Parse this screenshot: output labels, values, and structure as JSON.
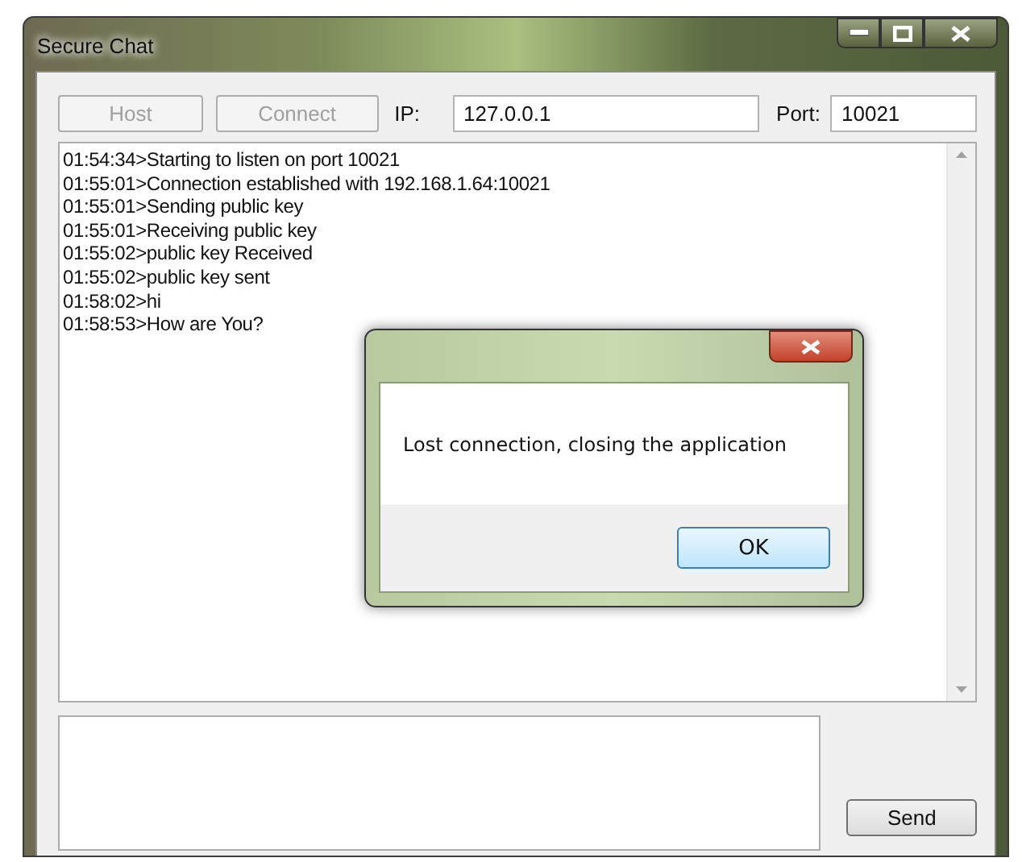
{
  "window": {
    "title": "Secure Chat"
  },
  "toolbar": {
    "buttons": [
      {
        "label": "Host",
        "disabled": true
      },
      {
        "label": "Connect",
        "disabled": true
      }
    ],
    "ip_label": "IP:",
    "ip_value": "127.0.0.1",
    "port_label": "Port:",
    "port_value": "10021"
  },
  "log": [
    "01:54:34>Starting to listen on port 10021",
    "01:55:01>Connection established with 192.168.1.64:10021",
    "01:55:01>Sending public key",
    "01:55:01>Receiving public key",
    "01:55:02>public key Received",
    "01:55:02>public key sent",
    "01:58:02>hi",
    "01:58:53>How are You?"
  ],
  "send_button": "Send",
  "dialog": {
    "message": "Lost connection, closing the application",
    "button": "OK"
  }
}
